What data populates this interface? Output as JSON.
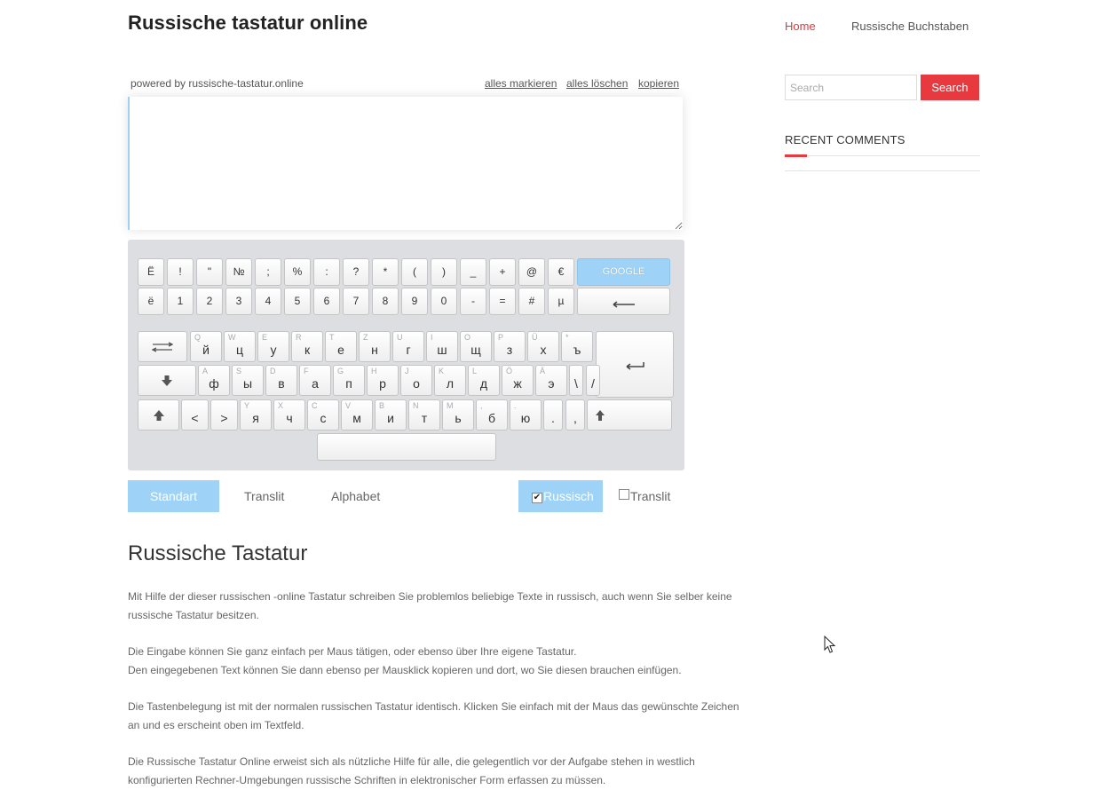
{
  "site": {
    "title": "Russische tastatur online"
  },
  "nav": {
    "home": "Home",
    "buchstaben": "Russische Buchstaben"
  },
  "toolbar": {
    "powered": "powered by russische-tastatur.online",
    "select_all": "alles markieren",
    "clear_all": "alles löschen",
    "copy": "kopieren"
  },
  "editor": {
    "value": ""
  },
  "keyboard": {
    "row1": [
      "Ё",
      "!",
      "\"",
      "№",
      ";",
      "%",
      ":",
      "?",
      "*",
      "(",
      ")",
      "_",
      "+",
      "@",
      "€"
    ],
    "google": "GOOGLE",
    "row2": [
      "ё",
      "1",
      "2",
      "3",
      "4",
      "5",
      "6",
      "7",
      "8",
      "9",
      "0",
      "-",
      "=",
      "#",
      "µ"
    ],
    "row3": [
      [
        "Q",
        "й"
      ],
      [
        "W",
        "ц"
      ],
      [
        "E",
        "у"
      ],
      [
        "R",
        "к"
      ],
      [
        "T",
        "е"
      ],
      [
        "Z",
        "н"
      ],
      [
        "U",
        "г"
      ],
      [
        "I",
        "ш"
      ],
      [
        "O",
        "щ"
      ],
      [
        "P",
        "з"
      ],
      [
        "Ü",
        "х"
      ],
      [
        "*",
        "ъ"
      ]
    ],
    "row4": [
      [
        "A",
        "ф"
      ],
      [
        "S",
        "ы"
      ],
      [
        "D",
        "в"
      ],
      [
        "F",
        "а"
      ],
      [
        "G",
        "п"
      ],
      [
        "H",
        "р"
      ],
      [
        "J",
        "о"
      ],
      [
        "K",
        "л"
      ],
      [
        "L",
        "д"
      ],
      [
        "Ö",
        "ж"
      ],
      [
        "Ä",
        "э"
      ],
      [
        "",
        "\\"
      ],
      [
        "",
        "/"
      ]
    ],
    "row5a": [
      "<",
      ">"
    ],
    "row5": [
      [
        "Y",
        "я"
      ],
      [
        "X",
        "ч"
      ],
      [
        "C",
        "с"
      ],
      [
        "V",
        "м"
      ],
      [
        "B",
        "и"
      ],
      [
        "N",
        "т"
      ],
      [
        "M",
        "ь"
      ],
      [
        ",",
        "б"
      ],
      [
        ".",
        "ю"
      ],
      [
        "",
        "."
      ],
      [
        "",
        ","
      ]
    ],
    "icons": {
      "tab": "tab-icon",
      "capslock": "caps-lock-icon",
      "shift": "shift-icon",
      "enter": "enter-icon",
      "backspace": "backspace-icon"
    }
  },
  "tabs": {
    "standart": "Standart",
    "translit": "Translit",
    "alphabet": "Alphabet"
  },
  "options": {
    "russisch": "Russisch",
    "translit": "Translit",
    "russisch_checked": true,
    "translit_checked": false
  },
  "content": {
    "heading": "Russische Tastatur",
    "p1": "Mit Hilfe der dieser russischen -online Tastatur schreiben Sie problemlos beliebige Texte in russisch, auch wenn Sie selber keine russische Tastatur besitzen.",
    "p2a": "Die Eingabe können Sie ganz einfach per Maus tätigen, oder ebenso über Ihre eigene Tastatur.",
    "p2b": "Den eingegebenen Text können Sie dann ebenso per Mausklick kopieren und dort, wo Sie diesen brauchen einfügen.",
    "p3": "Die Tastenbelegung ist mit der normalen russischen Tastatur identisch. Klicken Sie einfach mit der Maus das gewünschte Zeichen an und es erscheint oben im Textfeld.",
    "p4": "Die Russische Tastatur Online erweist sich als nützliche Hilfe für alle, die gelegentlich vor der Aufgabe stehen in westlich konfigurierten Rechner-Umgebungen russische Schriften in elektronischer Form erfassen zu müssen."
  },
  "sidebar": {
    "search_placeholder": "Search",
    "search_button": "Search",
    "recent_comments": "RECENT COMMENTS"
  },
  "colors": {
    "accent_red": "#e8393e",
    "accent_blue": "#9ed3f7",
    "keyboard_bg": "#dddee1"
  }
}
